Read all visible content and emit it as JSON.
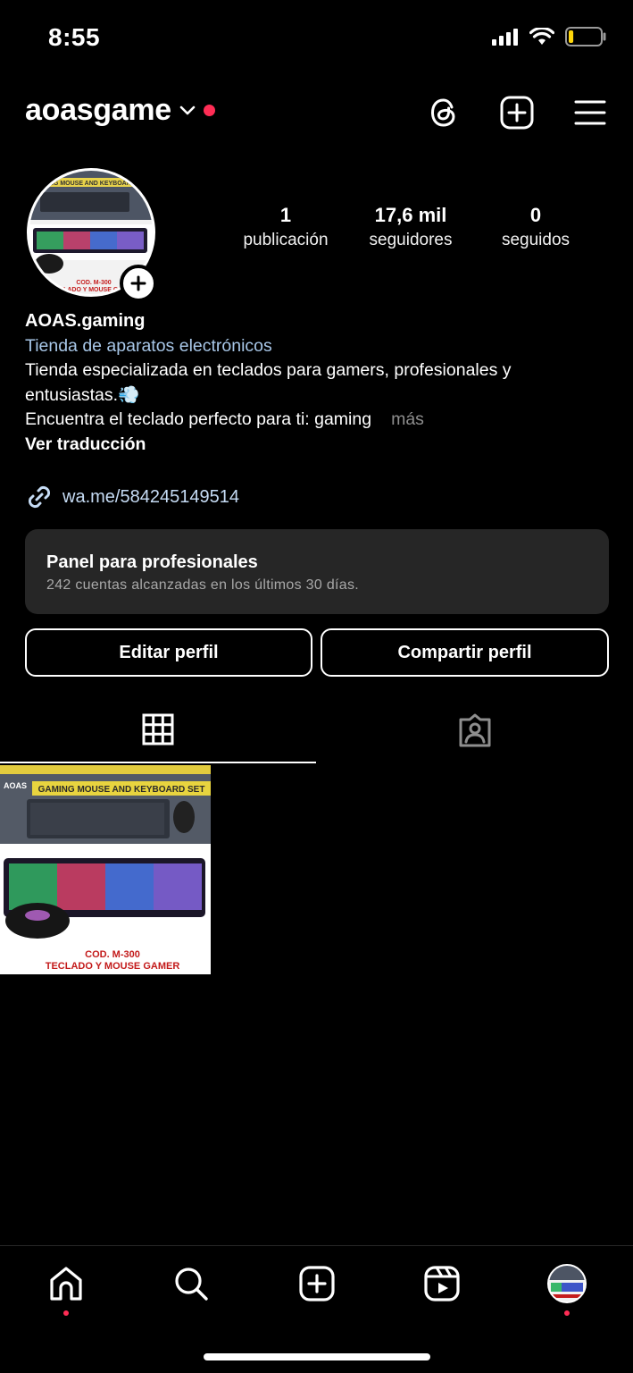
{
  "status_bar": {
    "time": "8:55",
    "battery_level": 0.15
  },
  "header": {
    "username": "aoasgame"
  },
  "profile": {
    "stats": [
      {
        "number": "1",
        "label": "publicación"
      },
      {
        "number": "17,6 mil",
        "label": "seguidores"
      },
      {
        "number": "0",
        "label": "seguidos"
      }
    ],
    "avatar_text": {
      "line1": "COD. M-300",
      "line2": "TECLADO Y MOUSE GAMER",
      "banner": "GAMING MOUSE AND KEYBOARD SET"
    },
    "bio": {
      "name": "AOAS.gaming",
      "category": "Tienda de aparatos electrónicos",
      "line1": "Tienda especializada en teclados para gamers, profesionales y",
      "line2": "entusiastas.",
      "emoji": "💨",
      "line3": "Encuentra el teclado perfecto para ti: gaming",
      "more": "más",
      "translate": "Ver traducción"
    },
    "link": "wa.me/584245149514"
  },
  "panel": {
    "title": "Panel para profesionales",
    "subtitle": "242 cuentas alcanzadas en los últimos 30 días."
  },
  "buttons": {
    "edit": "Editar perfil",
    "share": "Compartir perfil"
  },
  "post": {
    "brand": "AOAS",
    "banner": "GAMING MOUSE AND KEYBOARD SET",
    "code": "COD. M-300",
    "caption": "TECLADO Y MOUSE GAMER"
  },
  "colors": {
    "accent_red": "#ff2d55",
    "panel_bg": "#262626",
    "link": "#c6dcf5",
    "category": "#a8c7e8"
  },
  "icons": [
    "threads-icon",
    "create-icon",
    "menu-icon",
    "grid-icon",
    "tagged-icon",
    "home-icon",
    "search-icon",
    "reels-icon"
  ]
}
